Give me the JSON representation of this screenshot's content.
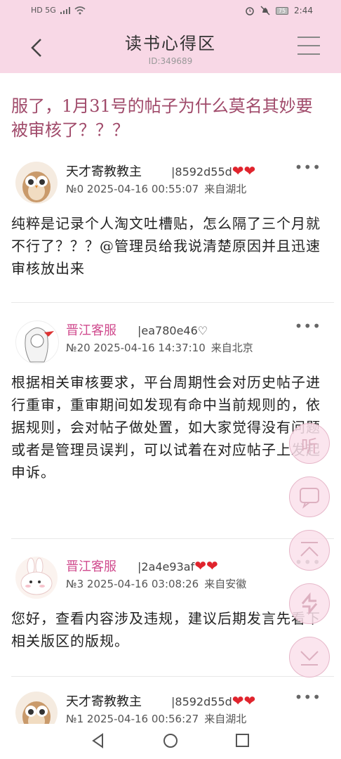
{
  "status_bar": {
    "left_text": "HD 5G",
    "time": "2:44",
    "battery": "75"
  },
  "header": {
    "title": "读书心得区",
    "id_label": "ID:349689"
  },
  "thread": {
    "title": "服了，1月31号的帖子为什么莫名其妙要被审核了？？？"
  },
  "posts": [
    {
      "username": "天才寄教教主",
      "user_id": "|8592d55d",
      "hearts": "❤❤",
      "meta": "№0  2025-04-16  00:55:07",
      "location": "来自湖北",
      "content": "纯粹是记录个人淘文吐槽贴，怎么隔了三个月就不行了？？？@管理员给我说清楚原因并且迅速审核放出来"
    },
    {
      "username": "晋江客服",
      "user_id": "|ea780e46♡",
      "hearts": "",
      "meta": "№20  2025-04-16  14:37:10",
      "location": "来自北京",
      "content": "根据相关审核要求，平台周期性会对历史帖子进行重审，重审期间如发现有命中当前规则的，依据规则，会对帖子做处置，如大家觉得没有问题或者是管理员误判，可以试着在对应帖子上发起申诉。"
    },
    {
      "username": "晋江客服",
      "user_id": "|2a4e93af",
      "hearts": "❤❤",
      "meta": "№3  2025-04-16  03:08:26",
      "location": "来自安徽",
      "content": "您好，查看内容涉及违规，建议后期发言先看下相关版区的版规。"
    },
    {
      "username": "天才寄教教主",
      "user_id": "|8592d55d",
      "hearts": "❤❤",
      "meta": "№1  2025-04-16  00:56:27",
      "location": "来自湖北",
      "content": ""
    }
  ],
  "more_label": "•••",
  "fabs": {
    "listen": "听"
  }
}
